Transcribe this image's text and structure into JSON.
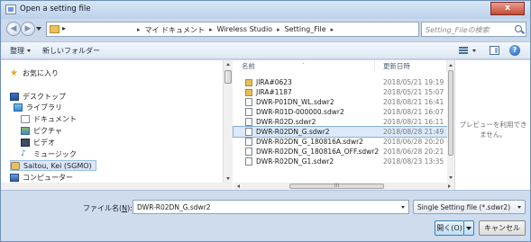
{
  "window": {
    "title": "Open a setting file",
    "buttons": {
      "minimize": "–",
      "maximize": "□",
      "close": "x"
    }
  },
  "address_bar": {
    "leading_arrow": "▸",
    "breadcrumbs": [
      "マイ ドキュメント",
      "Wireless Studio",
      "Setting_File"
    ],
    "crumb_separator": "▸",
    "search_placeholder": "Setting_Fileの検索"
  },
  "toolbar": {
    "organize": "整理",
    "new_folder": "新しいフォルダー"
  },
  "nav_pane": {
    "items": [
      {
        "label": "お気に入り",
        "icon": "star-icon"
      },
      {
        "label": "デスクトップ",
        "icon": "desktop-icon"
      },
      {
        "label": "ライブラリ",
        "icon": "library-icon"
      },
      {
        "label": "ドキュメント",
        "icon": "documents-icon"
      },
      {
        "label": "ピクチャ",
        "icon": "pictures-icon"
      },
      {
        "label": "ビデオ",
        "icon": "videos-icon"
      },
      {
        "label": "ミュージック",
        "icon": "music-icon"
      },
      {
        "label": "Saitou, Kei (SGMO)",
        "icon": "user-folder-icon",
        "selected": true
      },
      {
        "label": "コンピューター",
        "icon": "computer-icon"
      }
    ]
  },
  "file_list": {
    "columns": {
      "name": "名前",
      "date": "更新日時"
    },
    "rows": [
      {
        "name": "JIRA#0623",
        "date": "2018/05/21 19:19",
        "type": "folder"
      },
      {
        "name": "JIRA#1187",
        "date": "2018/05/21 15:07",
        "type": "folder"
      },
      {
        "name": "DWR-P01DN_WL.sdwr2",
        "date": "2018/08/21 16:41",
        "type": "file"
      },
      {
        "name": "DWR-R01D-000000.sdwr2",
        "date": "2018/08/21 16:07",
        "type": "file"
      },
      {
        "name": "DWR-R02D.sdwr2",
        "date": "2018/08/21 16:11",
        "type": "file"
      },
      {
        "name": "DWR-R02DN_G.sdwr2",
        "date": "2018/08/28 21:49",
        "type": "file",
        "selected": true
      },
      {
        "name": "DWR-R02DN_G_180816A.sdwr2",
        "date": "2018/06/28 20:20",
        "type": "file"
      },
      {
        "name": "DWR-R02DN_G_180816A_OFF.sdwr2",
        "date": "2018/06/28 20:21",
        "type": "file"
      },
      {
        "name": "DWR-R02DN_G1.sdwr2",
        "date": "2018/08/23 13:35",
        "type": "file"
      }
    ],
    "hscroll_thumb_label": "III"
  },
  "preview": {
    "message": "プレビューを利用できません。"
  },
  "footer": {
    "filename_label_prefix": "ファイル名(",
    "filename_label_key": "N",
    "filename_label_suffix": "):",
    "filename_value": "DWR-R02DN_G.sdwr2",
    "file_type": "Single Setting file (*.sdwr2)",
    "open_label": "開く(O)",
    "cancel_label": "キャンセル"
  },
  "colors": {
    "selection": "#dce9f9",
    "frame": "#cbd9eb",
    "close_button": "#c64a35"
  }
}
